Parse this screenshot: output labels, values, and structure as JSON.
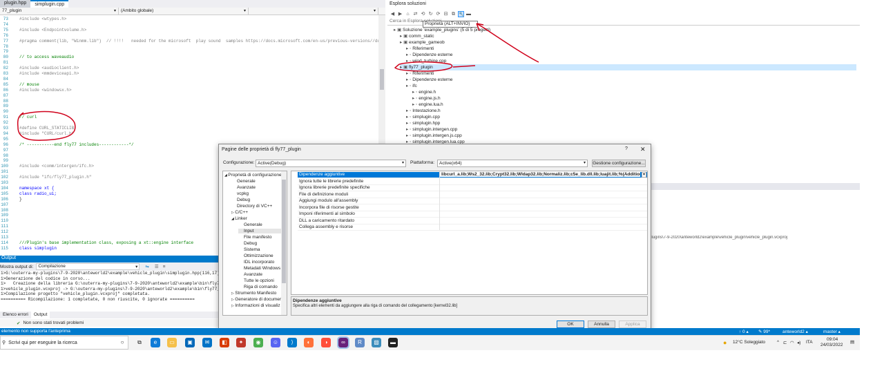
{
  "editor": {
    "tabs": [
      "plugin.hpp",
      "simplugin.cpp"
    ],
    "nav_left": "77_plugin",
    "nav_mid": "(Ambito globale)",
    "lines": [
      {
        "n": "73",
        "t": "#include <wtypes.h>"
      },
      {
        "n": "74",
        "t": ""
      },
      {
        "n": "75",
        "t": "#include <Endpointvolume.h>"
      },
      {
        "n": "76",
        "t": ""
      },
      {
        "n": "77",
        "t": "#pragma comment(lib, \"Winmm.lib\")  // !!!!   needed for the microsoft  play sound  samples https://docs.microsoft.com/en-us/previous-versions//dd743i"
      },
      {
        "n": "78",
        "t": ""
      },
      {
        "n": "79",
        "t": ""
      },
      {
        "n": "80",
        "t": "// to access waveaudio"
      },
      {
        "n": "81",
        "t": ""
      },
      {
        "n": "82",
        "t": "#include <audioclient.h>"
      },
      {
        "n": "83",
        "t": "#include <mmdeviceapi.h>"
      },
      {
        "n": "84",
        "t": ""
      },
      {
        "n": "85",
        "t": "// mouse"
      },
      {
        "n": "86",
        "t": "#include <windowsx.h>"
      },
      {
        "n": "87",
        "t": ""
      },
      {
        "n": "88",
        "t": ""
      },
      {
        "n": "89",
        "t": ""
      },
      {
        "n": "90",
        "t": ""
      },
      {
        "n": "91",
        "t": "// curl"
      },
      {
        "n": "92",
        "t": ""
      },
      {
        "n": "93",
        "t": "#define CURL_STATICLIB"
      },
      {
        "n": "94",
        "t": "#include \"CURL/curl.h\""
      },
      {
        "n": "95",
        "t": ""
      },
      {
        "n": "96",
        "t": "/* -----------end fly77 includes------------*/"
      },
      {
        "n": "97",
        "t": ""
      },
      {
        "n": "98",
        "t": ""
      },
      {
        "n": "99",
        "t": ""
      },
      {
        "n": "100",
        "t": "#include <comm/intergen/ifc.h>"
      },
      {
        "n": "101",
        "t": ""
      },
      {
        "n": "102",
        "t": "#include \"ifc/fly77_plugin.h\""
      },
      {
        "n": "103",
        "t": ""
      },
      {
        "n": "104",
        "t": "namespace xt {"
      },
      {
        "n": "105",
        "t": "class radio_ui;"
      },
      {
        "n": "106",
        "t": "}"
      },
      {
        "n": "107",
        "t": ""
      },
      {
        "n": "108",
        "t": ""
      },
      {
        "n": "109",
        "t": ""
      },
      {
        "n": "110",
        "t": ""
      },
      {
        "n": "111",
        "t": ""
      },
      {
        "n": "112",
        "t": ""
      },
      {
        "n": "113",
        "t": ""
      },
      {
        "n": "114",
        "t": "///Plugin's base implementation class, exposing a xt::engine interface"
      },
      {
        "n": "115",
        "t": "class simplugin"
      }
    ]
  },
  "output": {
    "title": "Output",
    "show_label": "Mostra output di:",
    "source": "Compilazione",
    "lines": [
      "1>G:\\outerra-my-plugins\\7-9-2020\\anteworld2\\example\\vehicle_plugin\\simplugin.hpp(116,17): w",
      "1>Generazione del codice in corso...",
      "1>   Creazione della libreria G:\\outerra-my-plugins\\7-9-2020\\anteworld2\\example\\bin\\fly77_p",
      "1>vehicle_plugin.vcxproj -> G:\\outerra-my-plugins\\7-9-2020\\anteworld2\\example\\bin\\fly77_pl",
      "1>Compilazione progetto \"vehicle_plugin.vcxproj\" completata.",
      "========== Ricompilazione: 1 completate, 0 non riuscite, 0 ignorate =========="
    ],
    "tabs": [
      "Elenco errori",
      "Output"
    ],
    "status": "Non sono stati trovati problemi"
  },
  "solution": {
    "title": "Esplora soluzioni",
    "search_placeholder": "Cerca in Esplora soluzioni",
    "tooltip": "Proprietà (ALT+INVIO)",
    "items": [
      {
        "label": "Soluzione 'example_plugins' (5 di 5 progetti)",
        "indent": 0
      },
      {
        "label": "comm_static",
        "indent": 1
      },
      {
        "label": "example_gameob",
        "indent": 1
      },
      {
        "label": "Riferimenti",
        "indent": 2
      },
      {
        "label": "Dipendenze esterne",
        "indent": 2
      },
      {
        "label": "wind_turbine.cpp",
        "indent": 2
      },
      {
        "label": "fly77_plugin",
        "indent": 1,
        "selected": true
      },
      {
        "label": "Riferimenti",
        "indent": 2
      },
      {
        "label": "Dipendenze esterne",
        "indent": 2
      },
      {
        "label": "ifc",
        "indent": 2
      },
      {
        "label": "engine.h",
        "indent": 3
      },
      {
        "label": "engine.js.h",
        "indent": 3
      },
      {
        "label": "engine.lua.h",
        "indent": 3
      },
      {
        "label": "Intestazione.h",
        "indent": 2
      },
      {
        "label": "simplugin.cpp",
        "indent": 2
      },
      {
        "label": "simplugin.hpp",
        "indent": 2
      },
      {
        "label": "simplugin.intergen.cpp",
        "indent": 2
      },
      {
        "label": "simplugin.intergen.js.cpp",
        "indent": 2
      },
      {
        "label": "simplugin.intergen.lua.cpp",
        "indent": 2
      }
    ]
  },
  "prop_pane": {
    "path": "plugins\\7-9-2020\\anteworld2\\example\\vehicle_plugin\\vehicle_plugin.vcxproj"
  },
  "dialog": {
    "title": "Pagine delle proprietà di fly77_plugin",
    "help": "?",
    "close": "✕",
    "config_label": "Configurazione:",
    "config_value": "Active(Debug)",
    "platform_label": "Piattaforma:",
    "platform_value": "Active(x64)",
    "config_manager": "Gestione configurazione...",
    "tree": [
      {
        "label": "Proprietà di configurazione",
        "indent": 0,
        "exp": "◢"
      },
      {
        "label": "Generale",
        "indent": 1
      },
      {
        "label": "Avanzate",
        "indent": 1
      },
      {
        "label": "vcpkg",
        "indent": 1
      },
      {
        "label": "Debug",
        "indent": 1
      },
      {
        "label": "Directory di VC++",
        "indent": 1
      },
      {
        "label": "C/C++",
        "indent": 1,
        "exp": "▷"
      },
      {
        "label": "Linker",
        "indent": 1,
        "exp": "◢"
      },
      {
        "label": "Generale",
        "indent": 2
      },
      {
        "label": "Input",
        "indent": 2,
        "selected": true
      },
      {
        "label": "File manifesto",
        "indent": 2
      },
      {
        "label": "Debug",
        "indent": 2
      },
      {
        "label": "Sistema",
        "indent": 2
      },
      {
        "label": "Ottimizzazione",
        "indent": 2
      },
      {
        "label": "IDL incorporato",
        "indent": 2
      },
      {
        "label": "Metadati Windows",
        "indent": 2
      },
      {
        "label": "Avanzate",
        "indent": 2
      },
      {
        "label": "Tutte le opzioni",
        "indent": 2
      },
      {
        "label": "Riga di comando",
        "indent": 2
      },
      {
        "label": "Strumento Manifesto",
        "indent": 1,
        "exp": "▷"
      },
      {
        "label": "Generatore di documer",
        "indent": 1,
        "exp": "▷"
      },
      {
        "label": "Informazioni di visualiz",
        "indent": 1,
        "exp": "▷"
      }
    ],
    "props": [
      {
        "name": "Dipendenze aggiuntive",
        "value": "libcurl_a.lib;Ws2_32.lib;Crypt32.lib;Wldap32.lib;Normaliz.lib;c5e_lib.dll.lib;luajit.lib;%(AdditionalDependenc",
        "selected": true
      },
      {
        "name": "Ignora tutte le librerie predefinite",
        "value": ""
      },
      {
        "name": "Ignora librerie predefinite specifiche",
        "value": ""
      },
      {
        "name": "File di definizione moduli",
        "value": ""
      },
      {
        "name": "Aggiungi modulo all'assembly",
        "value": ""
      },
      {
        "name": "Incorpora file di risorse gestite",
        "value": ""
      },
      {
        "name": "Imponi riferimenti al simbolo",
        "value": ""
      },
      {
        "name": "DLL a caricamento ritardato",
        "value": ""
      },
      {
        "name": "Collega assembly e risorse",
        "value": ""
      }
    ],
    "desc_title": "Dipendenze aggiuntive",
    "desc_text": "Specifica altri elementi da aggiungere alla riga di comando del collegamento [kernel32.lib]",
    "ok": "OK",
    "cancel": "Annulla",
    "apply": "Applica"
  },
  "statusbar": {
    "left": "elemento non supporta l'anteprima",
    "arrows": "↑ 0 ▴",
    "branch_count": "✎ 99*",
    "repo": "anteworld2 ▴",
    "branch": "master ▴"
  },
  "taskbar": {
    "search_placeholder": "Scrivi qui per eseguire la ricerca",
    "weather": "12°C  Soleggiato",
    "lang": "ITA",
    "time": "09:04",
    "date": "24/03/2022"
  }
}
